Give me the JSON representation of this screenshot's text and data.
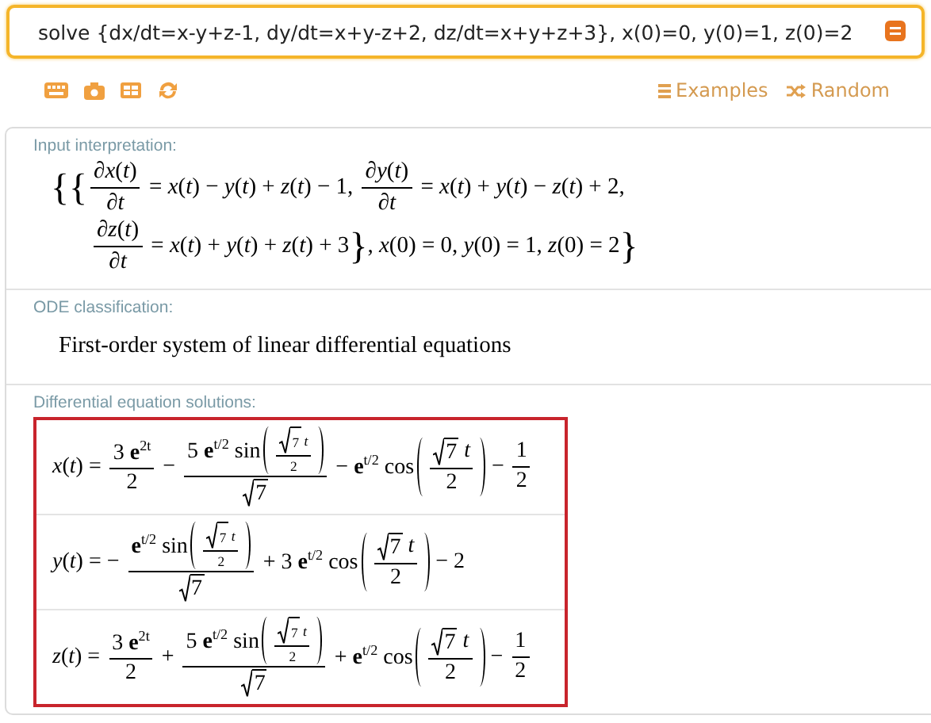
{
  "search": {
    "value": "solve {dx/dt=x-y+z-1, dy/dt=x+y-z+2, dz/dt=x+y+z+3}, x(0)=0, y(0)=1, z(0)=2"
  },
  "links": [
    {
      "label": "Examples"
    },
    {
      "label": "Random"
    }
  ],
  "pods": [
    {
      "title": "Input interpretation:",
      "kind": "math",
      "lines": [
        [
          {
            "big": "{{"
          },
          {
            "frac": [
              [
                "∂*x*(*t*)"
              ],
              [
                "∂*t*"
              ]
            ]
          },
          " = *x*(*t*) − *y*(*t*) + *z*(*t*) − 1, ",
          {
            "frac": [
              [
                "∂*y*(*t*)"
              ],
              [
                "∂*t*"
              ]
            ]
          },
          " = *x*(*t*) + *y*(*t*) − *z*(*t*) + 2,"
        ],
        [
          {
            "frac": [
              [
                "∂*z*(*t*)"
              ],
              [
                "∂*t*"
              ]
            ]
          },
          " = *x*(*t*) + *y*(*t*) + *z*(*t*) + 3",
          {
            "big": "}"
          },
          ", *x*(0) = 0, *y*(0) = 1, *z*(0) = 2",
          {
            "big": "}"
          }
        ]
      ]
    },
    {
      "title": "ODE classification:",
      "kind": "text",
      "text": "First-order system of linear differential equations"
    },
    {
      "title": "Differential equation solutions:",
      "kind": "solutions",
      "highlighted": true,
      "rows": [
        {
          "formula": [
            "*x*(*t*) = ",
            {
              "frac": [
                [
                  "3 **e**$^{2t}$"
                ],
                [
                  "2"
                ]
              ]
            },
            " − ",
            {
              "frac": [
                [
                  "5 **e**$^{t/2}$ sin",
                  {
                    "paren": [
                      {
                        "frac": [
                          [
                            {
                              "sqrt": [
                                "7"
                              ]
                            },
                            " *t*"
                          ],
                          [
                            "2"
                          ]
                        ]
                      }
                    ]
                  }
                ],
                [
                  {
                    "sqrt": [
                      "7"
                    ]
                  }
                ]
              ]
            },
            " − **e**$^{t/2}$ cos",
            {
              "paren": [
                {
                  "frac": [
                    [
                      {
                        "sqrt": [
                          "7"
                        ]
                      },
                      " *t*"
                    ],
                    [
                      "2"
                    ]
                  ]
                }
              ]
            },
            " − ",
            {
              "frac": [
                [
                  "1"
                ],
                [
                  "2"
                ]
              ]
            }
          ]
        },
        {
          "formula": [
            "*y*(*t*) = − ",
            {
              "frac": [
                [
                  "**e**$^{t/2}$ sin",
                  {
                    "paren": [
                      {
                        "frac": [
                          [
                            {
                              "sqrt": [
                                "7"
                              ]
                            },
                            " *t*"
                          ],
                          [
                            "2"
                          ]
                        ]
                      }
                    ]
                  }
                ],
                [
                  {
                    "sqrt": [
                      "7"
                    ]
                  }
                ]
              ]
            },
            " + 3 **e**$^{t/2}$ cos",
            {
              "paren": [
                {
                  "frac": [
                    [
                      {
                        "sqrt": [
                          "7"
                        ]
                      },
                      " *t*"
                    ],
                    [
                      "2"
                    ]
                  ]
                }
              ]
            },
            " − 2"
          ]
        },
        {
          "formula": [
            "*z*(*t*) = ",
            {
              "frac": [
                [
                  "3 **e**$^{2t}$"
                ],
                [
                  "2"
                ]
              ]
            },
            " + ",
            {
              "frac": [
                [
                  "5 **e**$^{t/2}$ sin",
                  {
                    "paren": [
                      {
                        "frac": [
                          [
                            {
                              "sqrt": [
                                "7"
                              ]
                            },
                            " *t*"
                          ],
                          [
                            "2"
                          ]
                        ]
                      }
                    ]
                  }
                ],
                [
                  {
                    "sqrt": [
                      "7"
                    ]
                  }
                ]
              ]
            },
            " + **e**$^{t/2}$ cos",
            {
              "paren": [
                {
                  "frac": [
                    [
                      {
                        "sqrt": [
                          "7"
                        ]
                      },
                      " *t*"
                    ],
                    [
                      "2"
                    ]
                  ]
                }
              ]
            },
            " − ",
            {
              "frac": [
                [
                  "1"
                ],
                [
                  "2"
                ]
              ]
            }
          ]
        }
      ]
    }
  ]
}
